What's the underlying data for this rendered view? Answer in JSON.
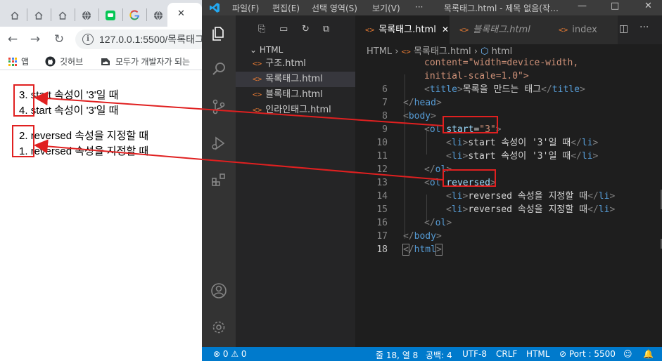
{
  "browser": {
    "tabs": [
      {
        "icon": "home-icon"
      },
      {
        "icon": "home-icon"
      },
      {
        "icon": "home-icon"
      },
      {
        "icon": "globe-icon"
      },
      {
        "icon": "line-chat-icon"
      },
      {
        "icon": "google-icon"
      },
      {
        "icon": "globe-icon"
      }
    ],
    "close_glyph": "✕",
    "url": "127.0.0.1:5500/목록태그.html",
    "bookmarks": [
      "앱",
      "깃허브",
      "모두가 개발자가 되는"
    ],
    "lists": [
      {
        "attr": "start",
        "items": [
          {
            "marker": "3.",
            "text": "start 속성이 '3'일 때"
          },
          {
            "marker": "4.",
            "text": "start 속성이 '3'일 때"
          }
        ]
      },
      {
        "attr": "reversed",
        "items": [
          {
            "marker": "2.",
            "text": "reversed 속성을 지정할 때"
          },
          {
            "marker": "1.",
            "text": "reversed 속성을 지정할 때"
          }
        ]
      }
    ]
  },
  "vscode": {
    "menu": [
      "파일(F)",
      "편집(E)",
      "선택 영역(S)",
      "보기(V)",
      "···"
    ],
    "window_title": "목록태그.html - 제목 없음(작업 영역) - Visual Studio Code",
    "explorer": {
      "folder": "HTML",
      "files": [
        "구조.html",
        "목록태그.html",
        "블록태그.html",
        "인라인태그.html"
      ],
      "selected_index": 1
    },
    "tabs": [
      {
        "label": "목록태그.html",
        "active": true,
        "close": "✕"
      },
      {
        "label": "블록태그.html",
        "active": false
      },
      {
        "label": "index",
        "active": false
      }
    ],
    "breadcrumbs": {
      "a": "HTML",
      "b": "목록태그.html",
      "c": "html"
    },
    "code": {
      "l_a": "content=\"width=device-width,",
      "l_b": "initial-scale=1.0\">",
      "title_text": "목록을 만드는 태그",
      "attr_start": "start",
      "attr_start_val": "\"3\"",
      "li1": "start 속성이 '3'일 때",
      "attr_reversed": "reversed",
      "li2": "reversed 속성을 지정할 때",
      "line_numbers": [
        "",
        "",
        "6",
        "7",
        "8",
        "9",
        "10",
        "11",
        "12",
        "13",
        "14",
        "15",
        "16",
        "17",
        "18"
      ]
    },
    "status": {
      "problems": "0",
      "warnings": "0",
      "position": "줄 18, 열 8",
      "indent": "공백: 4",
      "encoding": "UTF-8",
      "eol": "CRLF",
      "language": "HTML",
      "port": "Port : 5500"
    }
  },
  "colors": {
    "annotation_red": "#e02020",
    "statusbar": "#007acc"
  }
}
